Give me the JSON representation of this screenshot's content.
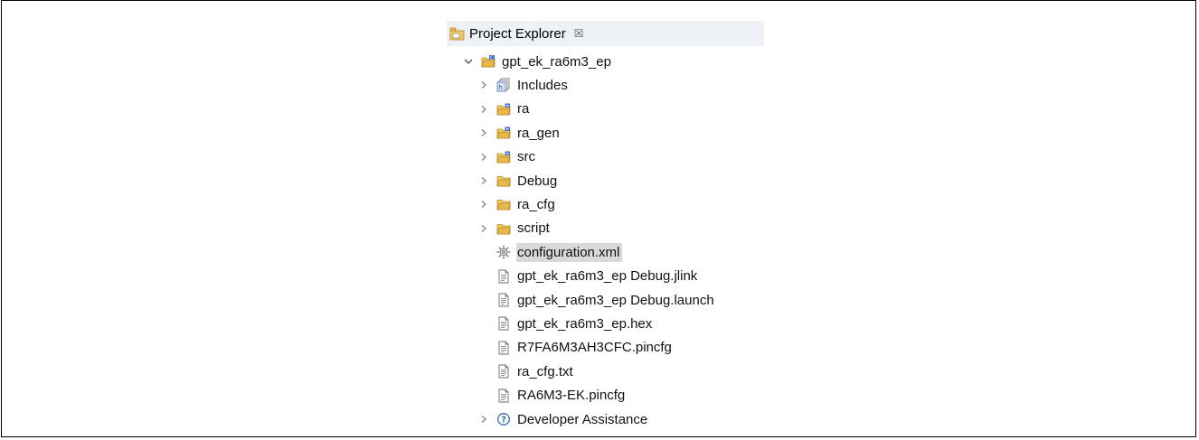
{
  "view": {
    "title": "Project Explorer",
    "close_symbol": "☒"
  },
  "tree": {
    "root": {
      "label": "gpt_ek_ra6m3_ep",
      "icon": "project-folder-icon",
      "expanded": true
    },
    "items": [
      {
        "label": "Includes",
        "icon": "includes-icon",
        "expandable": true
      },
      {
        "label": "ra",
        "icon": "source-folder-icon",
        "expandable": true
      },
      {
        "label": "ra_gen",
        "icon": "source-folder-icon",
        "expandable": true
      },
      {
        "label": "src",
        "icon": "source-folder-icon",
        "expandable": true
      },
      {
        "label": "Debug",
        "icon": "folder-icon",
        "expandable": true
      },
      {
        "label": "ra_cfg",
        "icon": "folder-icon",
        "expandable": true
      },
      {
        "label": "script",
        "icon": "folder-icon",
        "expandable": true
      },
      {
        "label": "configuration.xml",
        "icon": "gear-icon",
        "expandable": false,
        "selected": true
      },
      {
        "label": "gpt_ek_ra6m3_ep Debug.jlink",
        "icon": "file-icon",
        "expandable": false
      },
      {
        "label": "gpt_ek_ra6m3_ep Debug.launch",
        "icon": "file-icon",
        "expandable": false
      },
      {
        "label": "gpt_ek_ra6m3_ep.hex",
        "icon": "file-icon",
        "expandable": false
      },
      {
        "label": "R7FA6M3AH3CFC.pincfg",
        "icon": "file-icon",
        "expandable": false
      },
      {
        "label": "ra_cfg.txt",
        "icon": "file-icon",
        "expandable": false
      },
      {
        "label": "RA6M3-EK.pincfg",
        "icon": "file-icon",
        "expandable": false
      },
      {
        "label": "Developer Assistance",
        "icon": "help-icon",
        "expandable": true
      }
    ]
  },
  "colors": {
    "folder": "#e8b94a",
    "folder_dark": "#b8862a",
    "source_badge": "#3d6fc4",
    "header_bg": "#eef1f6",
    "selection": "#d9d9d9",
    "help": "#2f6db5"
  }
}
